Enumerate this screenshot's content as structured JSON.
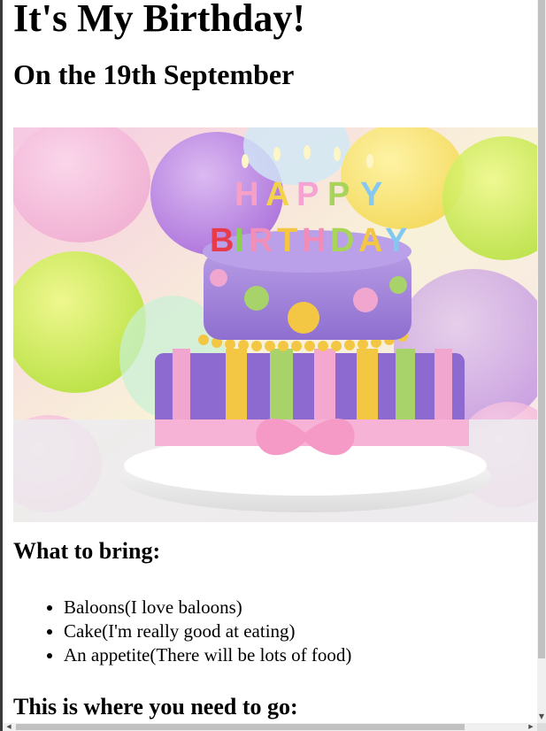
{
  "page": {
    "title": "It's My Birthday!",
    "date_heading": "On the 19th September",
    "image_alt": "Birthday cake with HAPPY BIRTHDAY candles",
    "cake_letters_top": [
      "H",
      "A",
      "P",
      "P",
      "Y"
    ],
    "cake_letters_bottom": [
      "B",
      "I",
      "R",
      "T",
      "H",
      "D",
      "A",
      "Y"
    ],
    "bring_heading": "What to bring:",
    "bring_items": [
      "Baloons(I love baloons)",
      "Cake(I'm really good at eating)",
      "An appetite(There will be lots of food)"
    ],
    "location_heading": "This is where you need to go:"
  },
  "scrollbar": {
    "down_arrow": "▼",
    "left_arrow": "◀",
    "right_arrow": "▶"
  }
}
